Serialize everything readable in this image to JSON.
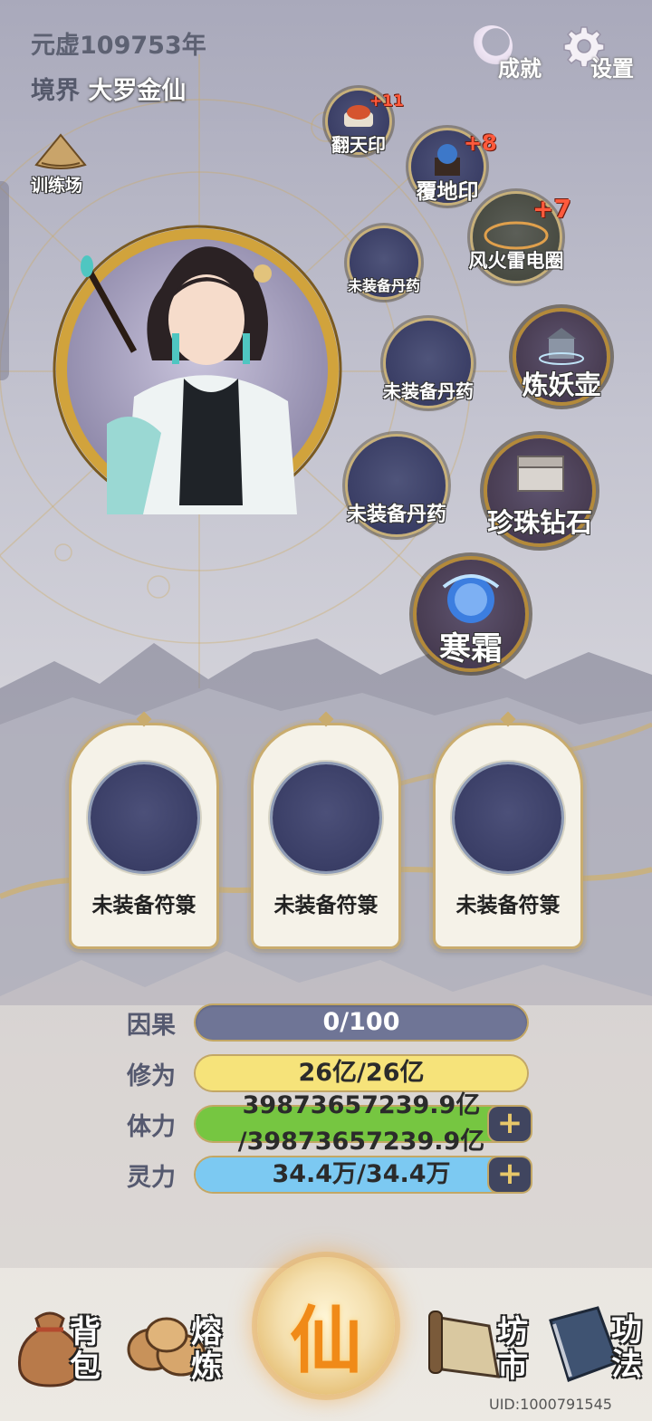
{
  "header": {
    "era": "元虚109753年",
    "realm_label": "境界",
    "realm_value": "大罗金仙",
    "achievements": "成就",
    "settings": "设置"
  },
  "training": "训练场",
  "artifacts": [
    {
      "name": "翻天印",
      "level": "+11"
    },
    {
      "name": "覆地印",
      "level": "+8"
    },
    {
      "name": "风火雷电圈",
      "level": "+7"
    }
  ],
  "pill_slots": [
    "未装备丹药",
    "未装备丹药",
    "未装备丹药"
  ],
  "items": [
    "炼妖壶",
    "珍珠钻石",
    "寒霜"
  ],
  "talisman_slots": [
    "未装备符箓",
    "未装备符箓",
    "未装备符箓"
  ],
  "stats": {
    "karma": {
      "label": "因果",
      "value": "0/100",
      "ratio": 0
    },
    "cultivation": {
      "label": "修为",
      "value": "26亿/26亿",
      "ratio": 1
    },
    "stamina": {
      "label": "体力",
      "value_line1": "39873657239.9亿",
      "value_line2": "/39873657239.9亿",
      "ratio": 1
    },
    "spirit": {
      "label": "灵力",
      "value": "34.4万/34.4万",
      "ratio": 1
    }
  },
  "nav": {
    "bag": [
      "背",
      "包"
    ],
    "smelt": [
      "熔",
      "炼"
    ],
    "center": "仙",
    "market": [
      "坊",
      "市"
    ],
    "skills": [
      "功",
      "法"
    ]
  },
  "uid": "UID:1000791545",
  "colors": {
    "karma_bar": "#6f7596",
    "cultivation_bar": "#f6e37a",
    "stamina_bar": "#76c641",
    "spirit_bar": "#7cc9f2",
    "plus": "#ff5a3c",
    "gold": "#c3a765"
  }
}
